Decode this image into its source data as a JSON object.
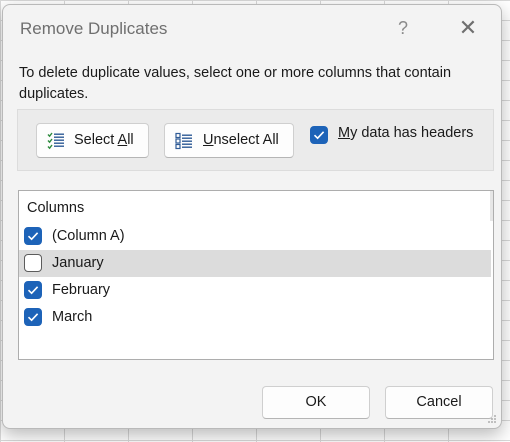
{
  "dialog": {
    "title": "Remove Duplicates",
    "help_label": "?",
    "close_label": "✕",
    "description": "To delete duplicate values, select one or more columns that contain duplicates."
  },
  "options": {
    "select_all": {
      "accel": "",
      "pre": "Select ",
      "key": "A",
      "post": "ll"
    },
    "unselect_all": {
      "pre": "",
      "key": "U",
      "post": "nselect All"
    },
    "headers": {
      "checked": true,
      "pre": "",
      "key": "M",
      "post": "y data has headers"
    }
  },
  "columns": {
    "header": "Columns",
    "items": [
      {
        "label": "(Column A)",
        "checked": true,
        "highlighted": false
      },
      {
        "label": "January",
        "checked": false,
        "highlighted": true
      },
      {
        "label": "February",
        "checked": true,
        "highlighted": false
      },
      {
        "label": "March",
        "checked": true,
        "highlighted": false
      }
    ]
  },
  "footer": {
    "ok_label": "OK",
    "cancel_label": "Cancel"
  },
  "colors": {
    "accent": "#1d63b8",
    "highlight_row": "#dcdcdc",
    "dialog_bg": "#f3f3f3"
  },
  "icons": {
    "select_all": "select-all-list-icon",
    "unselect_all": "unselect-all-list-icon",
    "help": "help-icon",
    "close": "close-icon"
  }
}
